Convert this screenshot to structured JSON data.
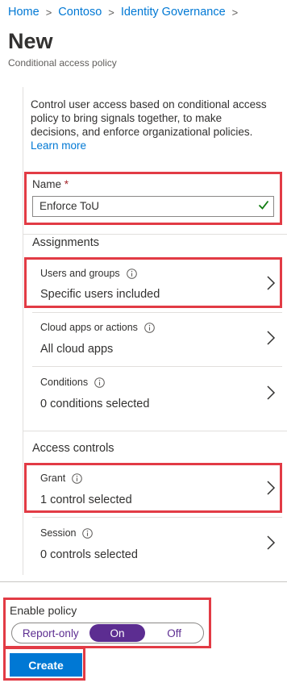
{
  "breadcrumb": [
    "Home",
    "Contoso",
    "Identity Governance"
  ],
  "page": {
    "title": "New",
    "subtitle": "Conditional access policy"
  },
  "intro": {
    "text": "Control user access based on conditional access policy to bring signals together, to make decisions, and enforce organizational policies.",
    "link": "Learn more"
  },
  "name_field": {
    "label": "Name",
    "required_marker": "*",
    "value": "Enforce ToU",
    "valid": true
  },
  "assignments": {
    "heading": "Assignments",
    "rows": [
      {
        "label": "Users and groups",
        "value": "Specific users included",
        "has_info": true
      },
      {
        "label": "Cloud apps or actions",
        "value": "All cloud apps",
        "has_info": true
      },
      {
        "label": "Conditions",
        "value": "0 conditions selected",
        "has_info": true
      }
    ]
  },
  "access_controls": {
    "heading": "Access controls",
    "rows": [
      {
        "label": "Grant",
        "value": "1 control selected",
        "has_info": true
      },
      {
        "label": "Session",
        "value": "0 controls selected",
        "has_info": true
      }
    ]
  },
  "enable_policy": {
    "label": "Enable policy",
    "options": [
      "Report-only",
      "On",
      "Off"
    ],
    "selected": "On"
  },
  "create_button": "Create",
  "colors": {
    "link": "#0078d4",
    "highlight": "#e23b45",
    "toggle_selected": "#5c2d91",
    "primary_button": "#0078d4",
    "valid_check": "#107c10"
  }
}
